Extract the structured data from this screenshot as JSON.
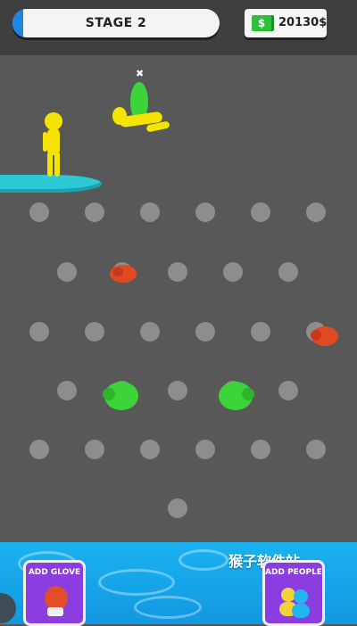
{
  "hud": {
    "stage_label": "STAGE 2",
    "stage_progress": 0.05,
    "money_icon": "dollar-bill-icon",
    "money_value": "20130$"
  },
  "buttons": {
    "add_glove": "ADD GLOVE",
    "add_people": "ADD PEOPLE"
  },
  "watermark": "猴子软件站",
  "colors": {
    "background": "#585858",
    "platform": "#2cc9d6",
    "green_glove": "#3dd43a",
    "red_glove": "#e04a22",
    "player": "#f5e400",
    "button": "#8b3de0"
  }
}
